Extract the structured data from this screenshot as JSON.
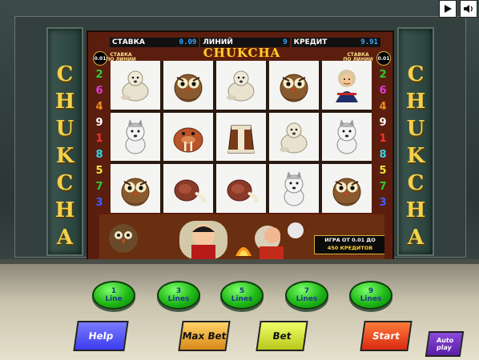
{
  "cabinet": {
    "side_title_letters": [
      "C",
      "H",
      "U",
      "K",
      "C",
      "H",
      "A"
    ]
  },
  "top_controls": {
    "play_label": "▶",
    "sound_label": "🔊"
  },
  "info_bar": {
    "bet_label": "СТАВКА",
    "bet_value": "0.09",
    "lines_label": "ЛИНИЙ",
    "lines_value": "9",
    "credit_label": "КРЕДИТ",
    "credit_value": "9.91"
  },
  "game": {
    "logo": "CHUKCHA",
    "bet_badge": "0.01",
    "stavka_note": "СТАВКА ПО ЛИНИИ"
  },
  "line_numbers_left": [
    {
      "n": "2",
      "color": "#2ecc2e"
    },
    {
      "n": "6",
      "color": "#e23ce0"
    },
    {
      "n": "4",
      "color": "#f08a20"
    },
    {
      "n": "9",
      "color": "#ffffff"
    },
    {
      "n": "1",
      "color": "#ff3030"
    },
    {
      "n": "8",
      "color": "#36d6e8"
    },
    {
      "n": "5",
      "color": "#f2e63a"
    },
    {
      "n": "7",
      "color": "#2ecc2e"
    },
    {
      "n": "3",
      "color": "#3a60ff"
    }
  ],
  "line_numbers_right": [
    {
      "n": "2",
      "color": "#2ecc2e"
    },
    {
      "n": "6",
      "color": "#e23ce0"
    },
    {
      "n": "4",
      "color": "#f08a20"
    },
    {
      "n": "9",
      "color": "#ffffff"
    },
    {
      "n": "1",
      "color": "#ff3030"
    },
    {
      "n": "8",
      "color": "#36d6e8"
    },
    {
      "n": "5",
      "color": "#f2e63a"
    },
    {
      "n": "7",
      "color": "#2ecc2e"
    },
    {
      "n": "3",
      "color": "#3a60ff"
    }
  ],
  "reels": [
    [
      "polar-bear-symbol",
      "husky-dog-symbol",
      "owl-symbol"
    ],
    [
      "owl-symbol",
      "walrus-symbol",
      "meat-leg-symbol"
    ],
    [
      "polar-bear-symbol",
      "fur-coat-symbol",
      "meat-leg-symbol"
    ],
    [
      "owl-symbol",
      "polar-bear-symbol",
      "husky-dog-symbol"
    ],
    [
      "chukcha-man-symbol",
      "husky-dog-symbol",
      "owl-symbol"
    ]
  ],
  "scene": {
    "info_line1": "ИГРА ОТ 0.01 ДО",
    "info_line2": "450 КРЕДИТОВ"
  },
  "line_buttons": [
    {
      "n": "1",
      "label": "Line"
    },
    {
      "n": "3",
      "label": "Lines"
    },
    {
      "n": "5",
      "label": "Lines"
    },
    {
      "n": "7",
      "label": "Lines"
    },
    {
      "n": "9",
      "label": "Lines"
    }
  ],
  "buttons": {
    "help": "Help",
    "max_bet": "Max Bet",
    "bet": "Bet",
    "start": "Start",
    "auto_play": "Auto play"
  }
}
